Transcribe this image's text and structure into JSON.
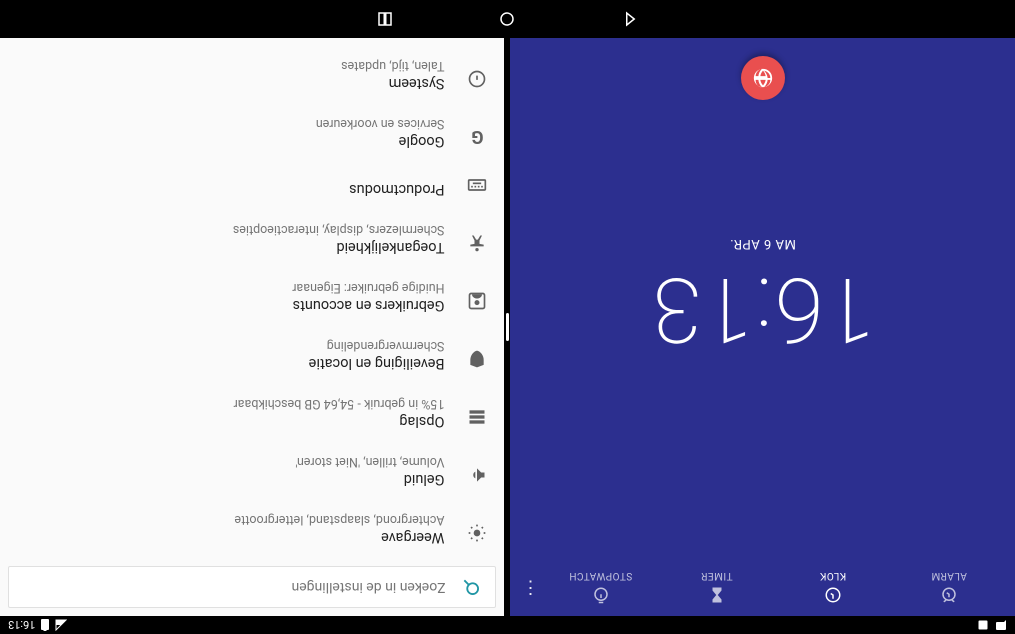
{
  "status": {
    "time": "16:13"
  },
  "clock": {
    "tabs": {
      "alarm": "ALARM",
      "clock": "KLOK",
      "timer": "TIMER",
      "stopwatch": "STOPWATCH"
    },
    "time": "16:13",
    "date": "MA 6 APR."
  },
  "settings": {
    "search_placeholder": "Zoeken in de instellingen",
    "items": [
      {
        "title": "Weergave",
        "sub": "Achtergrond, slaapstand, lettergrootte"
      },
      {
        "title": "Geluid",
        "sub": "Volume, trillen, 'Niet storen'"
      },
      {
        "title": "Opslag",
        "sub": "15% in gebruik - 54,64 GB beschikbaar"
      },
      {
        "title": "Beveiliging en locatie",
        "sub": "Schermvergrendeling"
      },
      {
        "title": "Gebruikers en accounts",
        "sub": "Huidige gebruiker: Eigenaar"
      },
      {
        "title": "Toegankelijkheid",
        "sub": "Schermlezers, display, interactieopties"
      },
      {
        "title": "Productmodus",
        "sub": ""
      },
      {
        "title": "Google",
        "sub": "Services en voorkeuren"
      },
      {
        "title": "Systeem",
        "sub": "Talen, tijd, updates"
      }
    ]
  }
}
